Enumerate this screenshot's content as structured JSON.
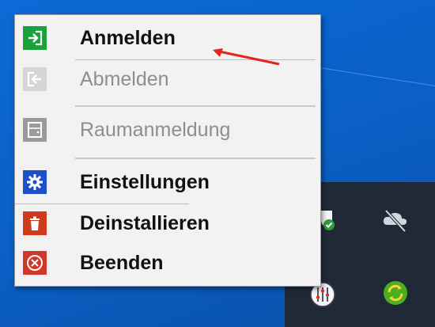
{
  "menu": {
    "items": [
      {
        "label": "Anmelden",
        "icon": "sign-in-icon",
        "enabled": true,
        "color": "#1aa33a"
      },
      {
        "label": "Abmelden",
        "icon": "sign-out-icon",
        "enabled": false,
        "color": "#c8c8c8"
      },
      {
        "label": "Raumanmeldung",
        "icon": "room-icon",
        "enabled": false,
        "color": "#9a9a9a"
      },
      {
        "label": "Einstellungen",
        "icon": "gear-icon",
        "enabled": true,
        "color": "#1d4fc7"
      },
      {
        "label": "Deinstallieren",
        "icon": "trash-icon",
        "enabled": true,
        "color": "#d03a1c"
      },
      {
        "label": "Beenden",
        "icon": "close-circle-icon",
        "enabled": true,
        "color": "#d2382a"
      }
    ]
  },
  "annotation": {
    "arrow_color": "#e8231f"
  },
  "tray": {
    "icons": [
      {
        "name": "shield-check-icon"
      },
      {
        "name": "cloud-offline-icon"
      },
      {
        "name": "audio-mixer-icon"
      },
      {
        "name": "sync-icon"
      }
    ]
  }
}
